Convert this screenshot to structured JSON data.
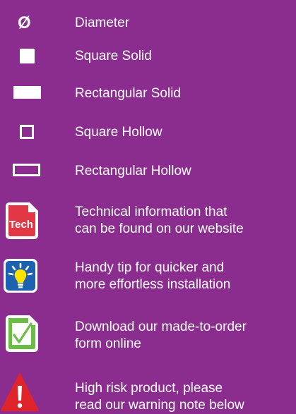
{
  "legend": {
    "items": [
      {
        "icon": "diameter-icon",
        "symbol": "Ø",
        "label": "Diameter"
      },
      {
        "icon": "square-solid-icon",
        "label": "Square Solid"
      },
      {
        "icon": "rectangular-solid-icon",
        "label": "Rectangular Solid"
      },
      {
        "icon": "square-hollow-icon",
        "label": "Square Hollow"
      },
      {
        "icon": "rectangular-hollow-icon",
        "label": "Rectangular Hollow"
      },
      {
        "icon": "tech-document-icon",
        "badge": "Tech",
        "lines": [
          "Technical information that",
          "can be found on our website"
        ]
      },
      {
        "icon": "lightbulb-tip-icon",
        "lines": [
          "Handy tip for quicker and",
          "more effortless installation"
        ]
      },
      {
        "icon": "checkmark-form-icon",
        "lines": [
          "Download our made-to-order",
          "form online"
        ]
      },
      {
        "icon": "warning-triangle-icon",
        "lines": [
          "High risk product, please",
          "read our warning note below"
        ]
      }
    ]
  },
  "colors": {
    "background": "#8b2c8f",
    "tech_red": "#e23744",
    "tip_blue": "#1c62b0",
    "download_green": "#6cbd45",
    "warning_red": "#e0242b",
    "bulb_yellow": "#ffe400",
    "text": "#ffffff"
  }
}
